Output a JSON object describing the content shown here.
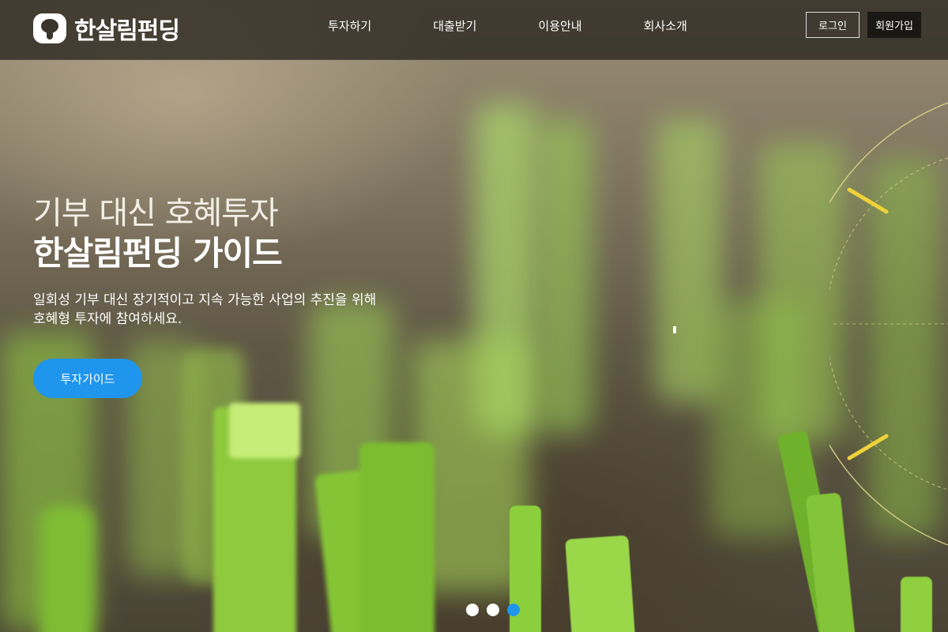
{
  "brand": {
    "name": "한살림펀딩",
    "logo_icon": "tree-logo-icon"
  },
  "nav": {
    "items": [
      "투자하기",
      "대출받기",
      "이용안내",
      "회사소개"
    ]
  },
  "auth": {
    "login_label": "로그인",
    "signup_label": "회원가입"
  },
  "hero": {
    "headline_line1": "기부 대신 호혜투자",
    "headline_line2": "한살림펀딩 가이드",
    "subtext_line1": "일회성 기부 대신 장기적이고 지속 가능한 사업의 추진을 위해",
    "subtext_line2": "호혜형 투자에 참여하세요.",
    "cta_label": "투자가이드",
    "background": "blurred green sprouts on soil"
  },
  "carousel": {
    "slide_count": 3,
    "active_index": 2
  },
  "colors": {
    "accent": "#1f95ee",
    "header_bg": "#28241e",
    "join_button_bg": "#1a1815"
  }
}
